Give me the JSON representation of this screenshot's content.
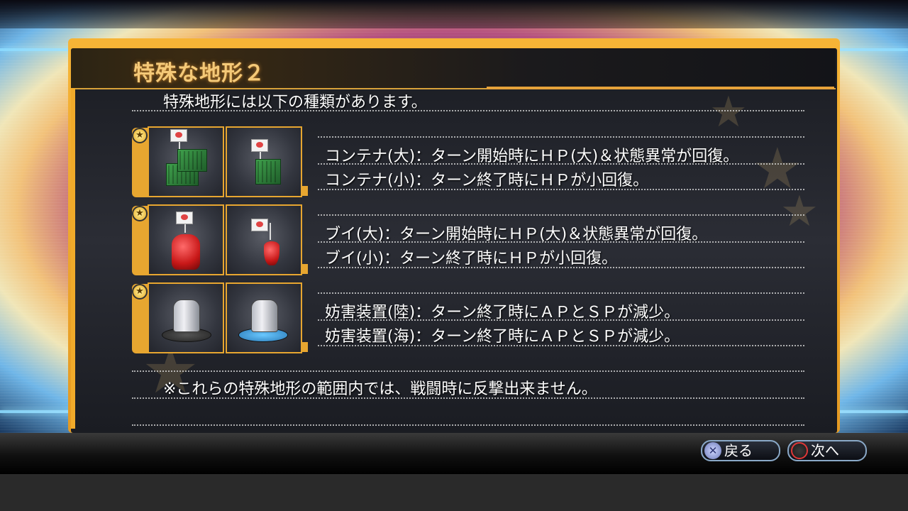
{
  "screen": {
    "title": "特殊な地形２",
    "intro": "特殊地形には以下の種類があります。",
    "note": "※これらの特殊地形の範囲内では、戦闘時に反撃出来ません。"
  },
  "terrains": [
    {
      "tiles": [
        {
          "icon": "container-large-icon"
        },
        {
          "icon": "container-small-icon"
        }
      ],
      "lines": [
        "コンテナ(大)：ターン開始時にＨＰ(大)＆状態異常が回復。",
        "コンテナ(小)：ターン終了時にＨＰが小回復。"
      ]
    },
    {
      "tiles": [
        {
          "icon": "buoy-large-icon"
        },
        {
          "icon": "buoy-small-icon"
        }
      ],
      "lines": [
        "ブイ(大)：ターン開始時にＨＰ(大)＆状態異常が回復。",
        "ブイ(小)：ターン終了時にＨＰが小回復。"
      ]
    },
    {
      "tiles": [
        {
          "icon": "jammer-land-icon"
        },
        {
          "icon": "jammer-sea-icon"
        }
      ],
      "lines": [
        "妨害装置(陸)：ターン終了時にＡＰとＳＰが減少。",
        "妨害装置(海)：ターン終了時にＡＰとＳＰが減少。"
      ]
    }
  ],
  "controls": {
    "back": {
      "icon": "cross-button-icon",
      "label": "戻る"
    },
    "next": {
      "icon": "circle-button-icon",
      "label": "次へ"
    }
  },
  "colors": {
    "panel_border": "#f0aa2a",
    "title_text": "#f4c978",
    "body_text": "#ffffff"
  }
}
